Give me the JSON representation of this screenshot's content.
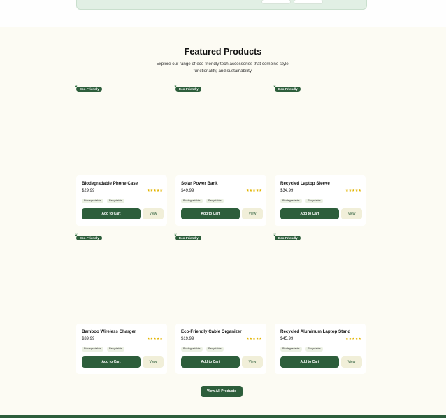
{
  "section": {
    "title": "Featured Products",
    "subtitle": "Explore our range of eco-friendly tech accessories that combine style, functionality, and sustainability."
  },
  "products": [
    {
      "badge": "Eco-Friendly",
      "name": "Biodegradable Phone Case",
      "price": "$29.99",
      "rating": "★★★★★",
      "tags": [
        "Biodegradable",
        "Recyclable"
      ],
      "add_label": "Add to Cart",
      "view_label": "View"
    },
    {
      "badge": "Eco-Friendly",
      "name": "Solar Power Bank",
      "price": "$49.99",
      "rating": "★★★★★",
      "tags": [
        "Biodegradable",
        "Recyclable"
      ],
      "add_label": "Add to Cart",
      "view_label": "View"
    },
    {
      "badge": "Eco-Friendly",
      "name": "Recycled Laptop Sleeve",
      "price": "$34.99",
      "rating": "★★★★★",
      "tags": [
        "Biodegradable",
        "Recyclable"
      ],
      "add_label": "Add to Cart",
      "view_label": "View"
    },
    {
      "badge": "Eco-Friendly",
      "name": "Bamboo Wireless Charger",
      "price": "$39.99",
      "rating": "★★★★★",
      "tags": [
        "Biodegradable",
        "Recyclable"
      ],
      "add_label": "Add to Cart",
      "view_label": "View"
    },
    {
      "badge": "Eco-Friendly",
      "name": "Eco-Friendly Cable Organizer",
      "price": "$19.99",
      "rating": "★★★★★",
      "tags": [
        "Biodegradable",
        "Recyclable"
      ],
      "add_label": "Add to Cart",
      "view_label": "View"
    },
    {
      "badge": "Eco-Friendly",
      "name": "Recycled Aluminum Laptop Stand",
      "price": "$45.99",
      "rating": "★★★★★",
      "tags": [
        "Biodegradable",
        "Recyclable"
      ],
      "add_label": "Add to Cart",
      "view_label": "View"
    }
  ],
  "view_all_label": "View All Products",
  "colors": {
    "primary": "#2d5e3b",
    "background": "#fcfbf3",
    "star": "#e2b400"
  }
}
